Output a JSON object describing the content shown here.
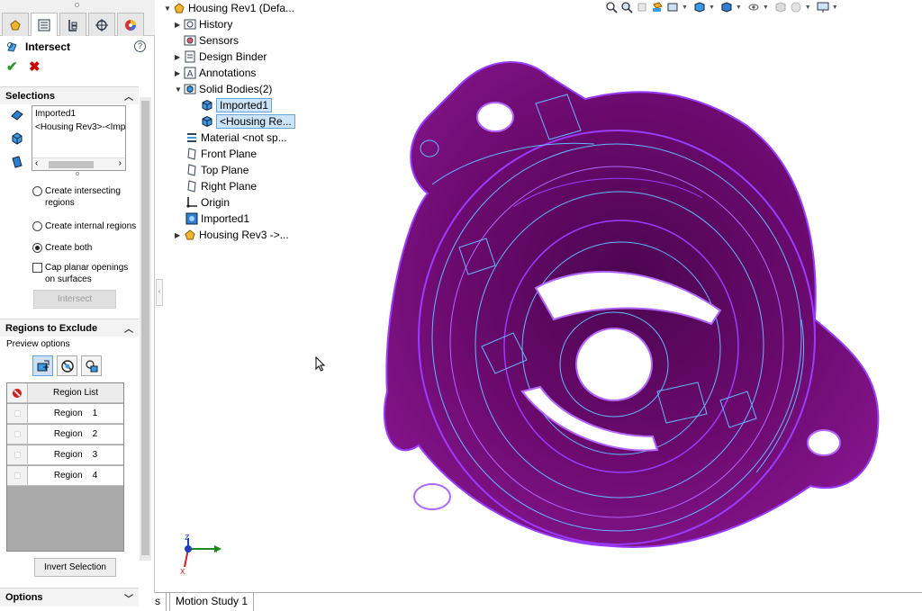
{
  "feature": {
    "title": "Intersect",
    "help_icon": "?"
  },
  "selections": {
    "header": "Selections",
    "items": [
      "Imported1",
      "<Housing Rev3>-<Imp"
    ],
    "options": [
      {
        "label": "Create intersecting regions",
        "selected": false
      },
      {
        "label": "Create internal regions",
        "selected": false
      },
      {
        "label": "Create both",
        "selected": true
      }
    ],
    "cap_label": "Cap planar openings on surfaces",
    "cap_checked": false,
    "intersect_button": "Intersect"
  },
  "regions": {
    "header": "Regions to Exclude",
    "preview_label": "Preview options",
    "list_header": "Region List",
    "rows": [
      "Region    1",
      "Region    2",
      "Region    3",
      "Region    4"
    ],
    "invert_button": "Invert Selection"
  },
  "options_header": "Options",
  "tree": {
    "root": "Housing Rev1  (Defa...",
    "items": [
      {
        "label": "History",
        "icon": "history-icon"
      },
      {
        "label": "Sensors",
        "icon": "sensors-icon"
      },
      {
        "label": "Design Binder",
        "icon": "design-binder-icon"
      },
      {
        "label": "Annotations",
        "icon": "annotations-icon"
      },
      {
        "label": "Solid Bodies(2)",
        "icon": "solid-bodies-icon"
      },
      {
        "label": "Imported1",
        "icon": "solid-body-icon"
      },
      {
        "label": "<Housing Re...",
        "icon": "solid-body-icon"
      },
      {
        "label": "Material <not sp...",
        "icon": "material-icon"
      },
      {
        "label": "Front Plane",
        "icon": "plane-icon"
      },
      {
        "label": "Top Plane",
        "icon": "plane-icon"
      },
      {
        "label": "Right Plane",
        "icon": "plane-icon"
      },
      {
        "label": "Origin",
        "icon": "origin-icon"
      },
      {
        "label": "Imported1",
        "icon": "imported-feature-icon"
      },
      {
        "label": "Housing Rev3 ->...",
        "icon": "part-icon"
      }
    ]
  },
  "bottom_tabs": [
    "s",
    "Motion Study 1"
  ],
  "triad": {
    "y": "Y",
    "z": "Z",
    "x": "X"
  },
  "colors": {
    "model_fill": "#6b0a6e",
    "model_edge": "#9a3cff",
    "model_highlight": "#62b8ff",
    "ok": "#2a9a2a",
    "cancel": "#d00000",
    "selection": "#cce4f7"
  }
}
